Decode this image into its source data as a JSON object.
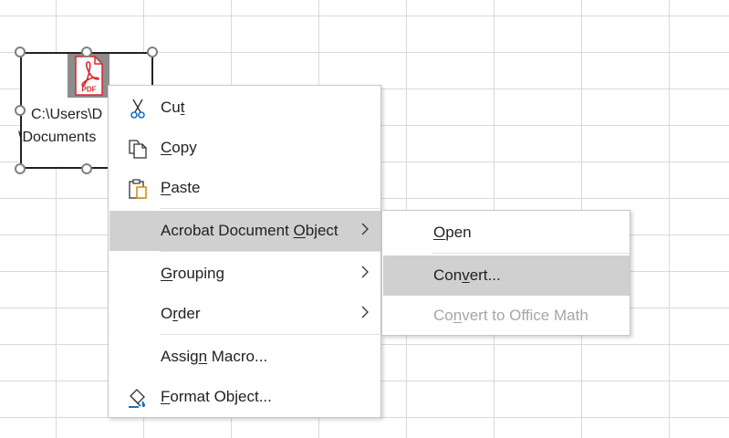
{
  "object": {
    "icon": "pdf-file-icon",
    "icon_label": "PDF",
    "path_line1": "C:\\Users\\D",
    "path_line2": "\\Documents"
  },
  "context_menu": {
    "items": [
      {
        "label_pre": "Cu",
        "mnemonic": "t",
        "label_post": "",
        "icon": "scissors-icon"
      },
      {
        "label_pre": "",
        "mnemonic": "C",
        "label_post": "opy",
        "icon": "copy-icon"
      },
      {
        "label_pre": "",
        "mnemonic": "P",
        "label_post": "aste",
        "icon": "paste-icon"
      },
      {
        "label_pre": "Acrobat Document ",
        "mnemonic": "O",
        "label_post": "bject",
        "has_submenu": true
      },
      {
        "label_pre": "",
        "mnemonic": "G",
        "label_post": "rouping",
        "has_submenu": true
      },
      {
        "label_pre": "O",
        "mnemonic": "r",
        "label_post": "der",
        "has_submenu": true
      },
      {
        "label_pre": "Assig",
        "mnemonic": "n",
        "label_post": " Macro...",
        "has_submenu": false
      },
      {
        "label_pre": "",
        "mnemonic": "F",
        "label_post": "ormat Object...",
        "icon": "format-object-icon"
      }
    ]
  },
  "submenu": {
    "items": [
      {
        "label_pre": "",
        "mnemonic": "O",
        "label_post": "pen",
        "state": "normal"
      },
      {
        "label_pre": "Con",
        "mnemonic": "v",
        "label_post": "ert...",
        "state": "hover"
      },
      {
        "label_pre": "Co",
        "mnemonic": "n",
        "label_post": "vert to Office Math",
        "state": "disabled"
      }
    ]
  },
  "colors": {
    "hover_bg": "#d0d0d0",
    "pdf_red": "#d9262a",
    "disabled_text": "#a6a6a6",
    "grid_line": "#d9d9d9"
  }
}
